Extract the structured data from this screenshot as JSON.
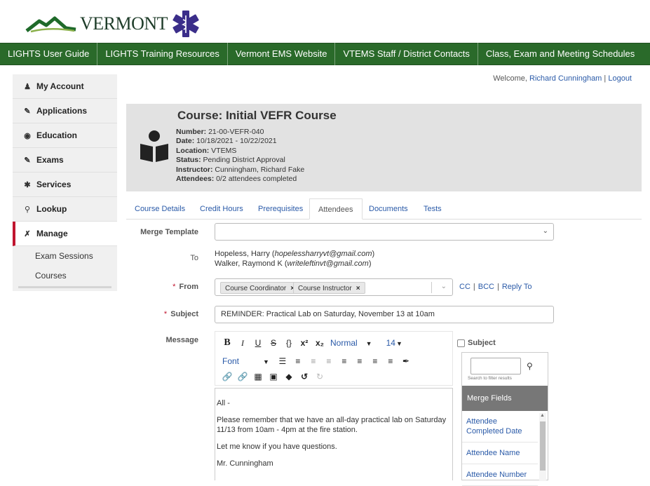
{
  "header": {
    "logo_text": "VERMONT"
  },
  "topnav": {
    "items": [
      {
        "label": "LIGHTS User Guide"
      },
      {
        "label": "LIGHTS Training Resources"
      },
      {
        "label": "Vermont EMS Website"
      },
      {
        "label": "VTEMS Staff / District Contacts"
      },
      {
        "label": "Class, Exam and Meeting Schedules"
      }
    ]
  },
  "sidebar": {
    "items": [
      {
        "label": "My Account",
        "icon": "person-icon"
      },
      {
        "label": "Applications",
        "icon": "form-icon"
      },
      {
        "label": "Education",
        "icon": "graduation-cap-icon"
      },
      {
        "label": "Exams",
        "icon": "form-icon"
      },
      {
        "label": "Services",
        "icon": "star-of-life-icon"
      },
      {
        "label": "Lookup",
        "icon": "search-icon"
      },
      {
        "label": "Manage",
        "icon": "tools-icon"
      }
    ],
    "subitems": [
      {
        "label": "Exam Sessions"
      },
      {
        "label": "Courses"
      }
    ]
  },
  "welcome": {
    "prefix": "Welcome, ",
    "user": "Richard Cunningham",
    "separator": " | ",
    "logout": "Logout"
  },
  "course": {
    "title": "Course: Initial VEFR Course",
    "fields": [
      {
        "label": "Number:",
        "value": " 21-00-VEFR-040"
      },
      {
        "label": "Date:",
        "value": " 10/18/2021 - 10/22/2021"
      },
      {
        "label": "Location:",
        "value": " VTEMS"
      },
      {
        "label": "Status:",
        "value": " Pending District Approval"
      },
      {
        "label": "Instructor:",
        "value": " Cunningham, Richard Fake"
      },
      {
        "label": "Attendees:",
        "value": " 0/2 attendees completed"
      }
    ]
  },
  "tabs": {
    "items": [
      {
        "label": "Course Details"
      },
      {
        "label": "Credit Hours"
      },
      {
        "label": "Prerequisites"
      },
      {
        "label": "Attendees"
      },
      {
        "label": "Documents"
      },
      {
        "label": "Tests"
      }
    ],
    "active": "Attendees"
  },
  "form": {
    "merge_template_label": "Merge Template",
    "merge_template_value": "",
    "to_label": "To",
    "recipients": [
      {
        "name": "Hopeless, Harry (",
        "email": "hopelessharryvt@gmail.com",
        "close": ")"
      },
      {
        "name": "Walker, Raymond K (",
        "email": "writeleftinvt@gmail.com",
        "close": ")"
      }
    ],
    "required_mark": "*",
    "from_label": "From",
    "from_chips": [
      "Course Coordinator",
      "Course Instructor"
    ],
    "chip_remove": "×",
    "cc": "CC",
    "bcc": "BCC",
    "reply_to": "Reply To",
    "link_sep": "|",
    "subject_label": "Subject",
    "subject_value": "REMINDER: Practical Lab on Saturday, November 13 at 10am",
    "message_label": "Message"
  },
  "editor": {
    "format_value": "Normal",
    "size_value": "14",
    "font_value": "Font",
    "body": [
      "All -",
      "Please remember that we have an all-day practical lab on Saturday 11/13 from 10am - 4pm at the fire station.",
      "Let me know if you have questions.",
      "Mr. Cunningham"
    ]
  },
  "merge": {
    "subject_checkbox_label": "Subject",
    "search_placeholder": "",
    "search_hint": "Search to filter results",
    "header": "Merge Fields",
    "items": [
      "Attendee Completed Date",
      "Attendee Name",
      "Attendee Number"
    ]
  },
  "colors": {
    "nav_green": "#2a6a2a",
    "accent_red": "#c0152f",
    "link_blue": "#2a5aa8",
    "panel_gray": "#e2e2e2",
    "star_of_life_blue": "#3b2e8a"
  }
}
